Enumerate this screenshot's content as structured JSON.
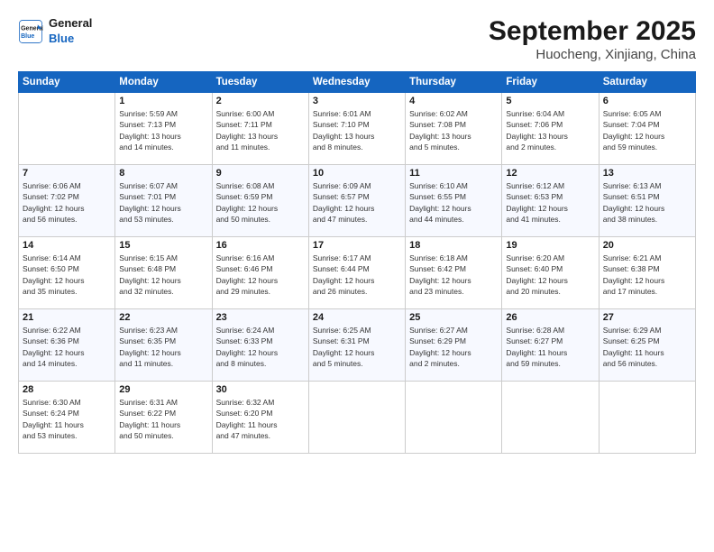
{
  "logo": {
    "line1": "General",
    "line2": "Blue"
  },
  "title": "September 2025",
  "location": "Huocheng, Xinjiang, China",
  "headers": [
    "Sunday",
    "Monday",
    "Tuesday",
    "Wednesday",
    "Thursday",
    "Friday",
    "Saturday"
  ],
  "weeks": [
    [
      {
        "day": "",
        "info": ""
      },
      {
        "day": "1",
        "info": "Sunrise: 5:59 AM\nSunset: 7:13 PM\nDaylight: 13 hours\nand 14 minutes."
      },
      {
        "day": "2",
        "info": "Sunrise: 6:00 AM\nSunset: 7:11 PM\nDaylight: 13 hours\nand 11 minutes."
      },
      {
        "day": "3",
        "info": "Sunrise: 6:01 AM\nSunset: 7:10 PM\nDaylight: 13 hours\nand 8 minutes."
      },
      {
        "day": "4",
        "info": "Sunrise: 6:02 AM\nSunset: 7:08 PM\nDaylight: 13 hours\nand 5 minutes."
      },
      {
        "day": "5",
        "info": "Sunrise: 6:04 AM\nSunset: 7:06 PM\nDaylight: 13 hours\nand 2 minutes."
      },
      {
        "day": "6",
        "info": "Sunrise: 6:05 AM\nSunset: 7:04 PM\nDaylight: 12 hours\nand 59 minutes."
      }
    ],
    [
      {
        "day": "7",
        "info": "Sunrise: 6:06 AM\nSunset: 7:02 PM\nDaylight: 12 hours\nand 56 minutes."
      },
      {
        "day": "8",
        "info": "Sunrise: 6:07 AM\nSunset: 7:01 PM\nDaylight: 12 hours\nand 53 minutes."
      },
      {
        "day": "9",
        "info": "Sunrise: 6:08 AM\nSunset: 6:59 PM\nDaylight: 12 hours\nand 50 minutes."
      },
      {
        "day": "10",
        "info": "Sunrise: 6:09 AM\nSunset: 6:57 PM\nDaylight: 12 hours\nand 47 minutes."
      },
      {
        "day": "11",
        "info": "Sunrise: 6:10 AM\nSunset: 6:55 PM\nDaylight: 12 hours\nand 44 minutes."
      },
      {
        "day": "12",
        "info": "Sunrise: 6:12 AM\nSunset: 6:53 PM\nDaylight: 12 hours\nand 41 minutes."
      },
      {
        "day": "13",
        "info": "Sunrise: 6:13 AM\nSunset: 6:51 PM\nDaylight: 12 hours\nand 38 minutes."
      }
    ],
    [
      {
        "day": "14",
        "info": "Sunrise: 6:14 AM\nSunset: 6:50 PM\nDaylight: 12 hours\nand 35 minutes."
      },
      {
        "day": "15",
        "info": "Sunrise: 6:15 AM\nSunset: 6:48 PM\nDaylight: 12 hours\nand 32 minutes."
      },
      {
        "day": "16",
        "info": "Sunrise: 6:16 AM\nSunset: 6:46 PM\nDaylight: 12 hours\nand 29 minutes."
      },
      {
        "day": "17",
        "info": "Sunrise: 6:17 AM\nSunset: 6:44 PM\nDaylight: 12 hours\nand 26 minutes."
      },
      {
        "day": "18",
        "info": "Sunrise: 6:18 AM\nSunset: 6:42 PM\nDaylight: 12 hours\nand 23 minutes."
      },
      {
        "day": "19",
        "info": "Sunrise: 6:20 AM\nSunset: 6:40 PM\nDaylight: 12 hours\nand 20 minutes."
      },
      {
        "day": "20",
        "info": "Sunrise: 6:21 AM\nSunset: 6:38 PM\nDaylight: 12 hours\nand 17 minutes."
      }
    ],
    [
      {
        "day": "21",
        "info": "Sunrise: 6:22 AM\nSunset: 6:36 PM\nDaylight: 12 hours\nand 14 minutes."
      },
      {
        "day": "22",
        "info": "Sunrise: 6:23 AM\nSunset: 6:35 PM\nDaylight: 12 hours\nand 11 minutes."
      },
      {
        "day": "23",
        "info": "Sunrise: 6:24 AM\nSunset: 6:33 PM\nDaylight: 12 hours\nand 8 minutes."
      },
      {
        "day": "24",
        "info": "Sunrise: 6:25 AM\nSunset: 6:31 PM\nDaylight: 12 hours\nand 5 minutes."
      },
      {
        "day": "25",
        "info": "Sunrise: 6:27 AM\nSunset: 6:29 PM\nDaylight: 12 hours\nand 2 minutes."
      },
      {
        "day": "26",
        "info": "Sunrise: 6:28 AM\nSunset: 6:27 PM\nDaylight: 11 hours\nand 59 minutes."
      },
      {
        "day": "27",
        "info": "Sunrise: 6:29 AM\nSunset: 6:25 PM\nDaylight: 11 hours\nand 56 minutes."
      }
    ],
    [
      {
        "day": "28",
        "info": "Sunrise: 6:30 AM\nSunset: 6:24 PM\nDaylight: 11 hours\nand 53 minutes."
      },
      {
        "day": "29",
        "info": "Sunrise: 6:31 AM\nSunset: 6:22 PM\nDaylight: 11 hours\nand 50 minutes."
      },
      {
        "day": "30",
        "info": "Sunrise: 6:32 AM\nSunset: 6:20 PM\nDaylight: 11 hours\nand 47 minutes."
      },
      {
        "day": "",
        "info": ""
      },
      {
        "day": "",
        "info": ""
      },
      {
        "day": "",
        "info": ""
      },
      {
        "day": "",
        "info": ""
      }
    ]
  ]
}
